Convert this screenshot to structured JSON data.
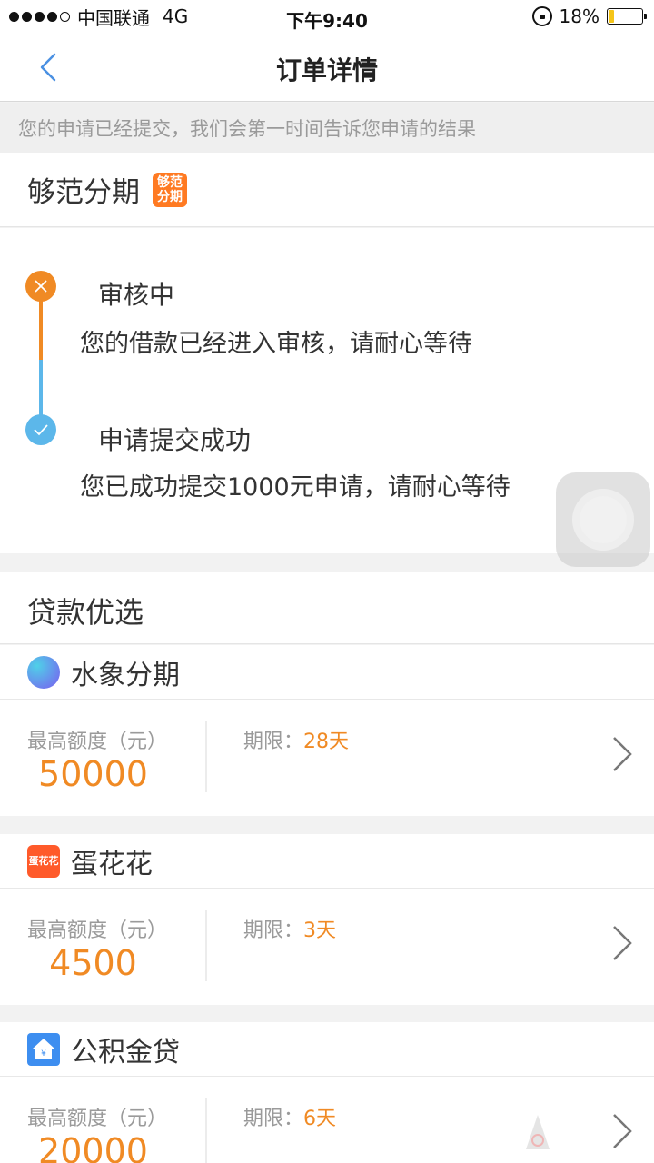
{
  "status_bar": {
    "carrier": "中国联通",
    "network": "4G",
    "time": "下午9:40",
    "battery_percent": "18%",
    "battery_level": 0.18
  },
  "nav": {
    "title": "订单详情"
  },
  "notice": "您的申请已经提交，我们会第一时间告诉您申请的结果",
  "provider": {
    "name": "够范分期",
    "logo_text_top": "够范",
    "logo_text_bottom": "分期"
  },
  "timeline": [
    {
      "title": "审核中",
      "desc": "您的借款已经进入审核，请耐心等待",
      "color": "#f08a24",
      "icon": "close-icon"
    },
    {
      "title": "申请提交成功",
      "desc": "您已成功提交1000元申请，请耐心等待",
      "color": "#5cb7ea",
      "icon": "check-icon"
    }
  ],
  "loans": {
    "header": "贷款优选",
    "amount_label": "最高额度（元）",
    "term_label": "期限：",
    "items": [
      {
        "name": "水象分期",
        "amount": "50000",
        "term": "28天",
        "icon": "water-icon"
      },
      {
        "name": "蛋花花",
        "amount": "4500",
        "term": "3天",
        "icon": "egg-icon",
        "logo_text": "蛋花花"
      },
      {
        "name": "公积金贷",
        "amount": "20000",
        "term": "6天",
        "icon": "house-icon"
      }
    ]
  },
  "colors": {
    "accent_orange": "#f08a24",
    "accent_blue": "#5cb7ea"
  }
}
